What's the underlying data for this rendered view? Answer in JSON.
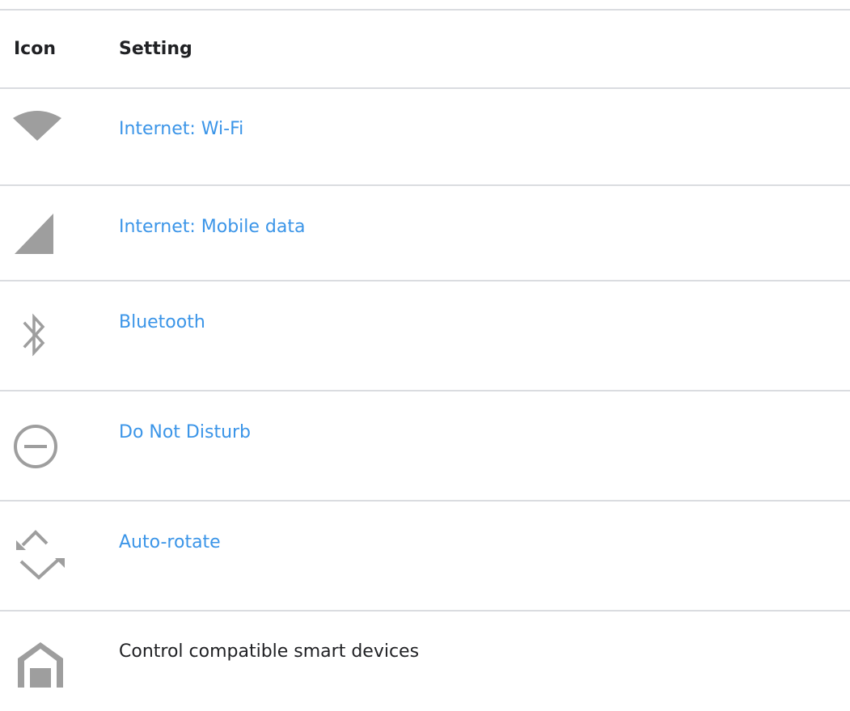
{
  "table": {
    "headers": {
      "icon": "Icon",
      "setting": "Setting"
    },
    "rows": [
      {
        "icon": "wifi-icon",
        "label": "Internet: Wi-Fi",
        "is_link": true
      },
      {
        "icon": "mobile-signal-icon",
        "label": "Internet: Mobile data",
        "is_link": true
      },
      {
        "icon": "bluetooth-icon",
        "label": "Bluetooth",
        "is_link": true
      },
      {
        "icon": "do-not-disturb-icon",
        "label": "Do Not Disturb",
        "is_link": true
      },
      {
        "icon": "auto-rotate-icon",
        "label": "Auto-rotate",
        "is_link": true
      },
      {
        "icon": "home-icon",
        "label": "Control compatible smart devices",
        "is_link": false
      }
    ]
  },
  "colors": {
    "link": "#3b95e8",
    "text": "#202124",
    "divider": "#dadce0",
    "icon_gray": "#9e9e9e"
  }
}
